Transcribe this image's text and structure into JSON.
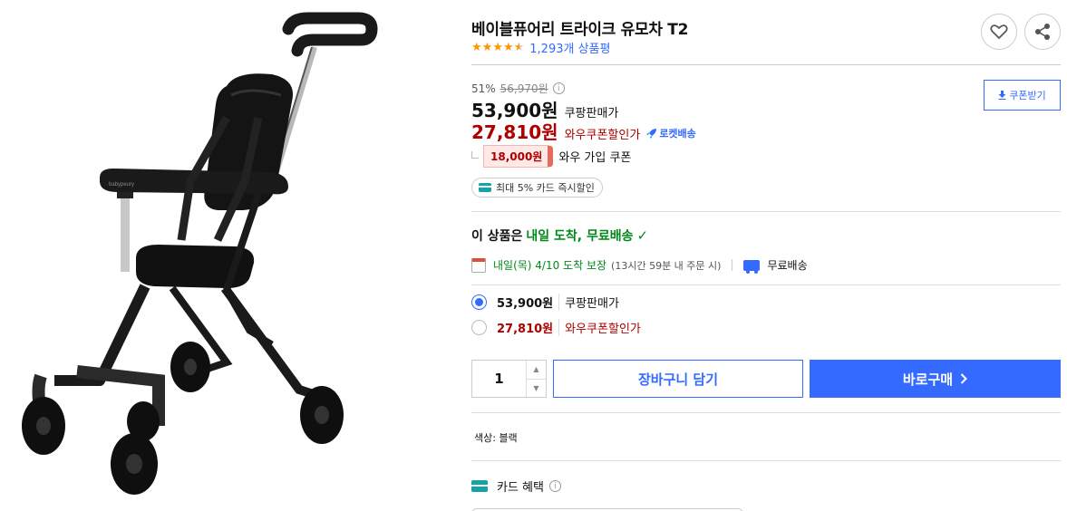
{
  "product": {
    "title": "베이블퓨어리 트라이크 유모차 T2",
    "rating": 4.5,
    "review_count": "1,293개 상품평"
  },
  "actions": {
    "heart_icon": "heart-icon",
    "share_icon": "share-icon",
    "coupon_download": "쿠폰받기"
  },
  "pricing": {
    "discount_rate": "51%",
    "original_price": "56,970원",
    "sale_price": "53,900원",
    "sale_label": "쿠팡판매가",
    "wow_price": "27,810원",
    "wow_label": "와우쿠폰할인가",
    "rocket_label": "로켓배송",
    "wow_coupon_amount": "18,000원",
    "wow_coupon_label": "와우 가입 쿠폰",
    "card_discount": "최대 5% 카드 즉시할인"
  },
  "delivery": {
    "head_prefix": "이 상품은",
    "head_highlight": "내일 도착, 무료배송",
    "arrival": "내일(목) 4/10 도착 보장",
    "arrival_note": "(13시간 59분 내 주문 시)",
    "shipping": "무료배송"
  },
  "price_options": [
    {
      "price": "53,900원",
      "label": "쿠팡판매가",
      "selected": true
    },
    {
      "price": "27,810원",
      "label": "와우쿠폰할인가",
      "selected": false
    }
  ],
  "purchase": {
    "quantity": "1",
    "cart_button": "장바구니 담기",
    "buy_button": "바로구매"
  },
  "option": {
    "text": "색상: 블랙"
  },
  "card_benefit": {
    "label": "카드 혜택"
  },
  "image": {
    "brand_text": "babypeury"
  },
  "colors": {
    "accent_blue": "#346aff",
    "wow_red": "#ae0000",
    "delivery_green": "#00891a",
    "star_orange": "#ff9600"
  }
}
